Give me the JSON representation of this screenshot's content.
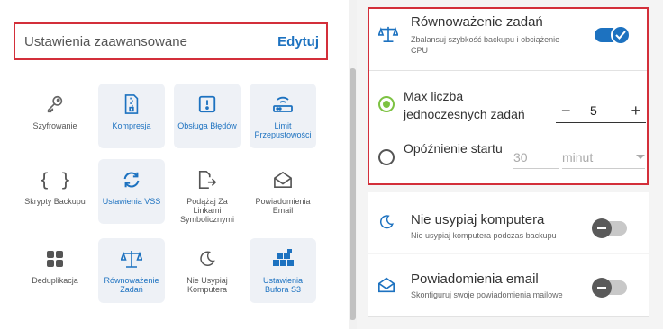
{
  "advanced": {
    "title": "Ustawienia zaawansowane",
    "edit_label": "Edytuj"
  },
  "tiles": [
    {
      "label": "Szyfrowanie",
      "icon": "key-icon",
      "active": false
    },
    {
      "label": "Kompresja",
      "icon": "compressed-file-icon",
      "active": true
    },
    {
      "label": "Obsługa Błędów",
      "icon": "error-box-icon",
      "active": true
    },
    {
      "label": "Limit Przepustowości",
      "icon": "router-icon",
      "active": true
    },
    {
      "label": "Skrypty Backupu",
      "icon": "braces-icon",
      "active": false
    },
    {
      "label": "Ustawienia VSS",
      "icon": "sync-icon",
      "active": true
    },
    {
      "label": "Podążaj Za Linkami Symbolicznymi",
      "icon": "file-link-icon",
      "active": false
    },
    {
      "label": "Powiadomienia Email",
      "icon": "envelope-icon",
      "active": false
    },
    {
      "label": "Deduplikacja",
      "icon": "grid-squares-icon",
      "active": false
    },
    {
      "label": "Równoważenie Zadań",
      "icon": "balance-scale-icon",
      "active": true
    },
    {
      "label": "Nie Usypiaj Komputera",
      "icon": "moon-icon",
      "active": false
    },
    {
      "label": "Ustawienia Bufora S3",
      "icon": "cubes-icon",
      "active": true
    }
  ],
  "balancing": {
    "title": "Równoważenie zadań",
    "description": "Zbalansuj szybkość backupu i obciążenie CPU",
    "enabled": true,
    "max_label": "Max liczba jednoczesnych zadań",
    "max_value": "5",
    "delay_label": "Opóźnienie startu",
    "delay_value": "30",
    "delay_unit": "minut"
  },
  "sleep": {
    "title": "Nie usypiaj komputera",
    "description": "Nie usypiaj komputera podczas backupu",
    "enabled": false
  },
  "email": {
    "title": "Powiadomienia email",
    "description": "Skonfiguruj swoje powiadomienia mailowe",
    "enabled": false
  },
  "colors": {
    "accent": "#1d72c0",
    "highlight_border": "#d32f3a",
    "radio_checked": "#7dc242"
  }
}
